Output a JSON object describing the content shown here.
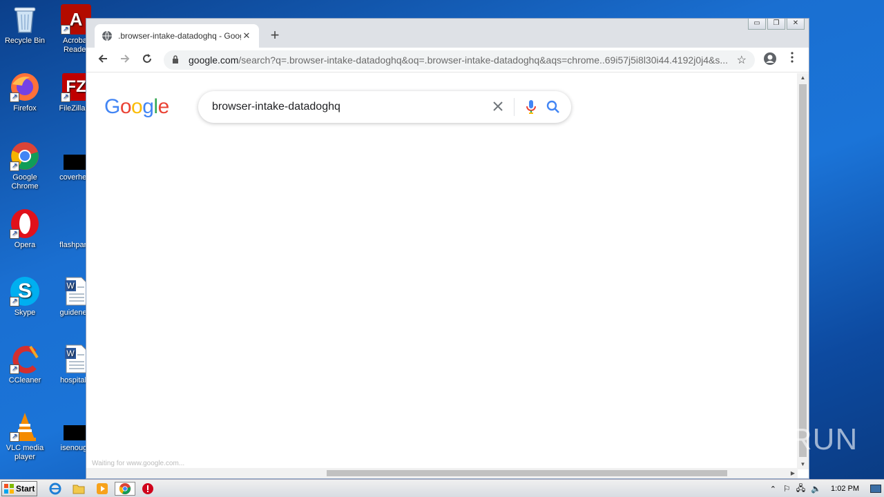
{
  "desktop": {
    "icons": [
      {
        "label": "Recycle Bin"
      },
      {
        "label": "Acrobat Reader"
      },
      {
        "label": "Firefox"
      },
      {
        "label": "FileZilla C"
      },
      {
        "label": "Google Chrome"
      },
      {
        "label": "coverheal"
      },
      {
        "label": "Opera"
      },
      {
        "label": "flashparty"
      },
      {
        "label": "Skype"
      },
      {
        "label": "guidenew"
      },
      {
        "label": "CCleaner"
      },
      {
        "label": "hospitalsl"
      },
      {
        "label": "VLC media player"
      },
      {
        "label": "isenough"
      }
    ]
  },
  "browser": {
    "tab_title": ".browser-intake-datadoghq - Google",
    "new_tab": "+",
    "window_controls": {
      "minimize": "▭",
      "restore": "❐",
      "close": "✕"
    },
    "url_host": "google.com",
    "url_rest": "/search?q=.browser-intake-datadoghq&oq=.browser-intake-datadoghq&aqs=chrome..69i57j5i8l30i44.4192j0j4&s...",
    "search": {
      "logo": "Google",
      "query": "browser-intake-datadoghq"
    },
    "status_url": "Waiting for www.google.com..."
  },
  "taskbar": {
    "start_label": "Start",
    "clock": "1:02 PM"
  },
  "watermark": "ANY RUN",
  "colors": {
    "google_blue": "#4285F4",
    "google_red": "#EA4335",
    "google_yellow": "#FBBC05",
    "google_green": "#34A853"
  }
}
